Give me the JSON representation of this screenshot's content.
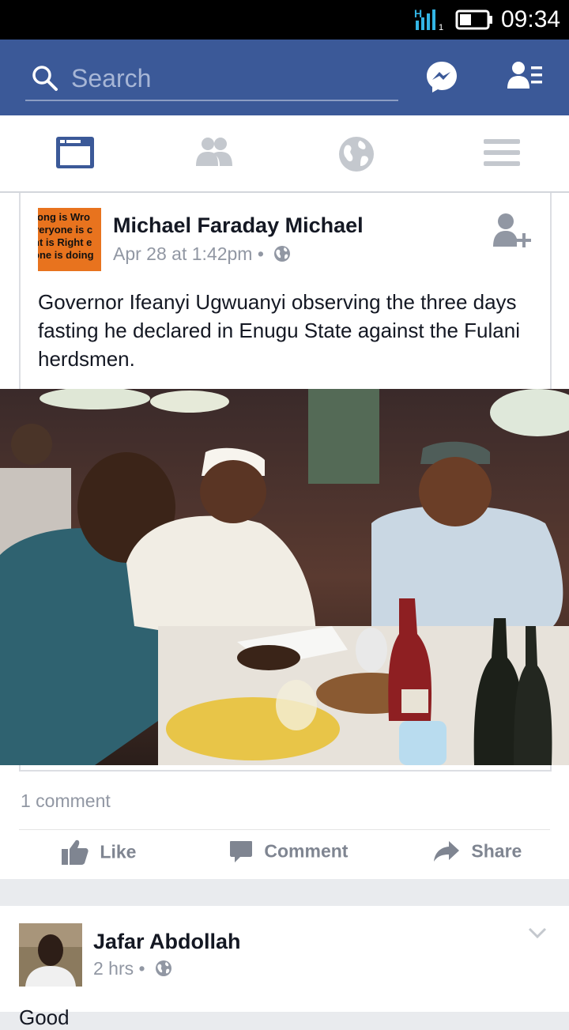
{
  "status_bar": {
    "time": "09:34",
    "signal_label": "H",
    "sim_slot": "1"
  },
  "header": {
    "search_placeholder": "Search"
  },
  "nav_tabs": [
    {
      "name": "news-feed",
      "active": true
    },
    {
      "name": "friend-requests",
      "active": false
    },
    {
      "name": "notifications",
      "active": false
    },
    {
      "name": "more",
      "active": false
    }
  ],
  "post1": {
    "avatar_lines": [
      "rong is Wro",
      "veryone is c",
      "ht is Right e",
      "one is doing"
    ],
    "author": "Michael Faraday Michael",
    "time": "Apr 28 at 1:42pm",
    "separator": "•",
    "privacy_icon": "globe-icon",
    "text": "Governor Ifeanyi Ugwuanyi observing the three days fasting he declared in Enugu State against the Fulani herdsmen.",
    "comments_count": "1 comment",
    "actions": {
      "like": "Like",
      "comment": "Comment",
      "share": "Share"
    }
  },
  "post2": {
    "author": "Jafar Abdollah",
    "time": "2 hrs",
    "separator": "•",
    "privacy_icon": "globe-icon",
    "text_partial": "Good"
  },
  "colors": {
    "brand_blue": "#3b5998",
    "muted_text": "#9197a3",
    "action_gray": "#7f8591"
  }
}
